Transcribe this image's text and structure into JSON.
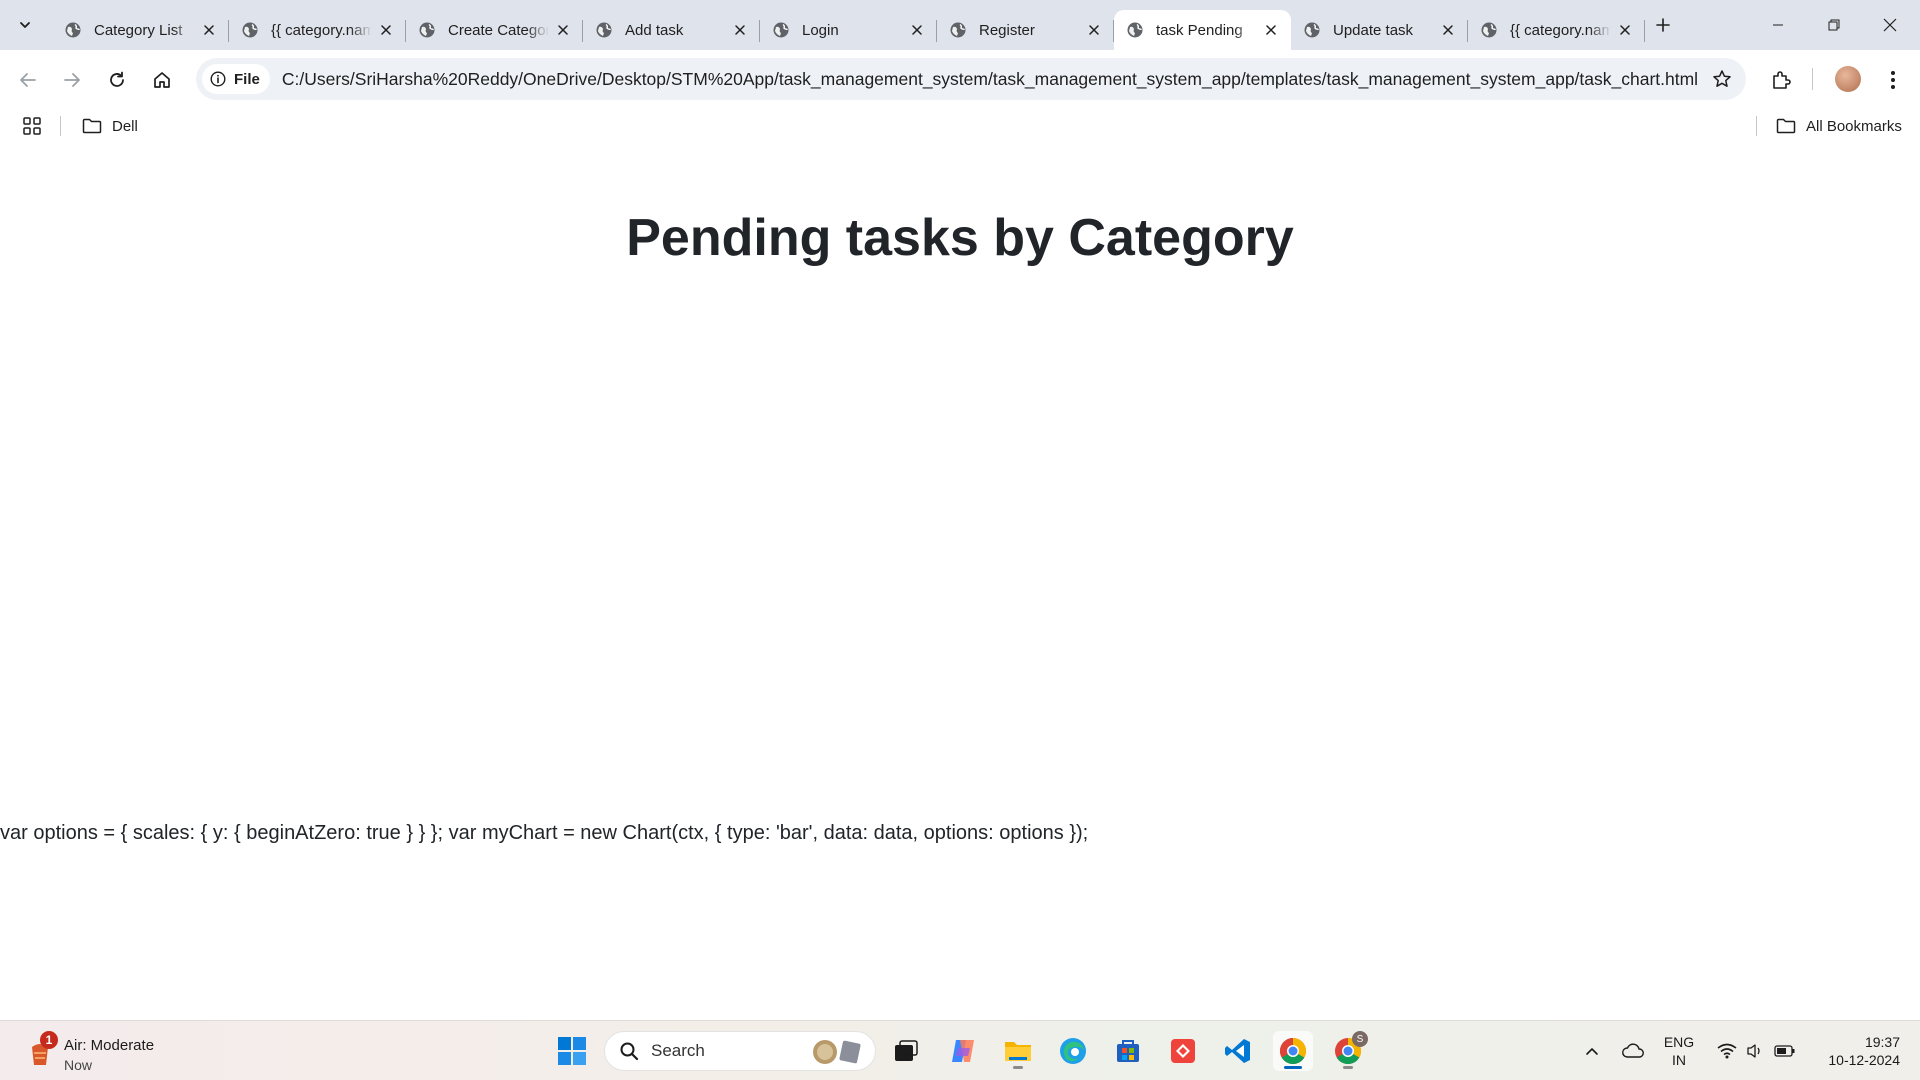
{
  "browser": {
    "tabs": [
      {
        "title": "Category List",
        "active": false
      },
      {
        "title": "{{ category.name }}",
        "active": false
      },
      {
        "title": "Create Category",
        "active": false
      },
      {
        "title": "Add task",
        "active": false
      },
      {
        "title": "Login",
        "active": false
      },
      {
        "title": "Register",
        "active": false
      },
      {
        "title": "task Pending",
        "active": true
      },
      {
        "title": "Update task",
        "active": false
      },
      {
        "title": "{{ category.name }}",
        "active": false
      }
    ],
    "omnibox": {
      "scheme_chip": "File",
      "url": "C:/Users/SriHarsha%20Reddy/OneDrive/Desktop/STM%20App/task_management_system/task_management_system_app/templates/task_management_system_app/task_chart.html"
    },
    "bookmarks": {
      "items": [
        {
          "label": "Dell",
          "icon": "folder-icon"
        }
      ],
      "all_bookmarks": "All Bookmarks"
    }
  },
  "page": {
    "heading": "Pending tasks by Category",
    "script_text": "var options = { scales: { y: { beginAtZero: true } } }; var myChart = new Chart(ctx, { type: 'bar', data: data, options: options });"
  },
  "taskbar": {
    "weather": {
      "badge": "1",
      "label": "Air: Moderate",
      "sub": "Now"
    },
    "search_label": "Search",
    "language": {
      "line1": "ENG",
      "line2": "IN"
    },
    "clock": {
      "time": "19:37",
      "date": "10-12-2024"
    },
    "chrome_profile_badge": "S"
  },
  "colors": {
    "tabstrip": "#dfe3eb",
    "omnibox": "#eef1f6",
    "text": "#212529",
    "windows_blue": "#0078d4"
  }
}
